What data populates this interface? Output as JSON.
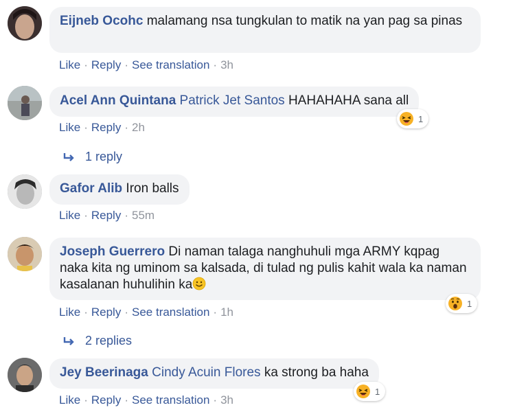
{
  "comments": [
    {
      "author": "Eijneb Ocohc",
      "mention": "",
      "text": "malamang nsa tungkulan to matik na yan pag sa pinas",
      "actions": {
        "like": "Like",
        "reply": "Reply",
        "translate": "See translation",
        "time": "3h"
      }
    },
    {
      "author": "Acel Ann Quintana",
      "mention": "Patrick Jet Santos",
      "text": "HAHAHAHA sana all",
      "actions": {
        "like": "Like",
        "reply": "Reply",
        "time": "2h"
      },
      "reaction": {
        "icon": "haha-emoji-icon",
        "count": "1"
      },
      "replies_label": "1 reply"
    },
    {
      "author": "Gafor Alib",
      "mention": "",
      "text": "Iron balls",
      "actions": {
        "like": "Like",
        "reply": "Reply",
        "time": "55m"
      }
    },
    {
      "author": "Joseph Guerrero",
      "mention": "",
      "text": "Di naman talaga nanghuhuli mga ARMY kqpag naka kita ng uminom sa kalsada, di tulad ng pulis kahit wala ka naman kasalanan huhulihin ka",
      "emoji": "smile-emoji-icon",
      "actions": {
        "like": "Like",
        "reply": "Reply",
        "translate": "See translation",
        "time": "1h"
      },
      "reaction": {
        "icon": "wow-emoji-icon",
        "count": "1"
      },
      "replies_label": "2 replies"
    },
    {
      "author": "Jey Beerinaga",
      "mention": "Cindy Acuin Flores",
      "text": "ka strong ba haha",
      "actions": {
        "like": "Like",
        "reply": "Reply",
        "translate": "See translation",
        "time": "3h"
      },
      "reaction": {
        "icon": "haha-emoji-icon",
        "count": "1"
      }
    }
  ],
  "separator": "·"
}
